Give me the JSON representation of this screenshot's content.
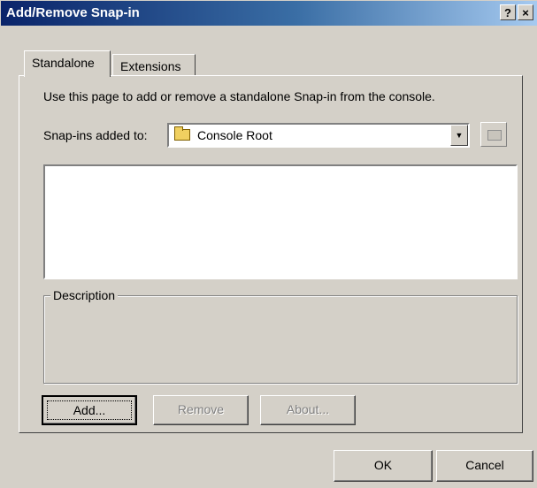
{
  "window": {
    "title": "Add/Remove Snap-in",
    "help_label": "?",
    "close_label": "×"
  },
  "tabs": [
    {
      "label": "Standalone",
      "active": true
    },
    {
      "label": "Extensions",
      "active": false
    }
  ],
  "standalone": {
    "intro_text": "Use this page to add or remove a standalone Snap-in from the console.",
    "snapins_added_to_label": "Snap-ins added to:",
    "snapins_added_to_value": "Console Root",
    "snapin_list": [],
    "description_label": "Description",
    "description_text": ""
  },
  "panel_buttons": {
    "add_label": "Add...",
    "remove_label": "Remove",
    "about_label": "About..."
  },
  "footer_buttons": {
    "ok_label": "OK",
    "cancel_label": "Cancel"
  },
  "icons": {
    "combo_item": "folder-icon",
    "combo_dropdown": "chevron-down-icon",
    "up_level": "up-one-level-icon"
  }
}
